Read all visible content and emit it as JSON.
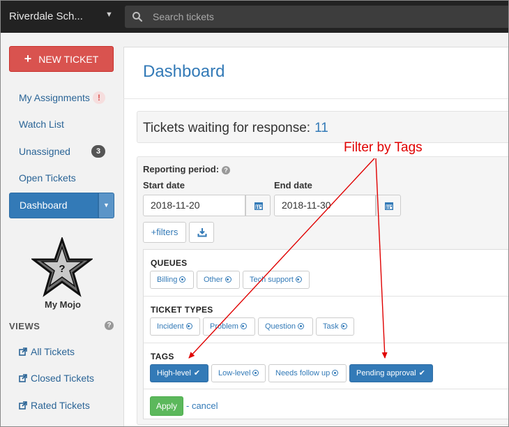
{
  "topbar": {
    "org_name": "Riverdale Sch...",
    "search_placeholder": "Search tickets"
  },
  "sidebar": {
    "new_ticket_label": "NEW TICKET",
    "items": [
      {
        "label": "My Assignments",
        "badge": "!"
      },
      {
        "label": "Watch List"
      },
      {
        "label": "Unassigned",
        "badge": "3"
      },
      {
        "label": "Open Tickets"
      },
      {
        "label": "Dashboard",
        "active": true
      }
    ],
    "mojo": {
      "label": "My Mojo",
      "glyph": "?"
    },
    "views_heading": "VIEWS",
    "views_help": "?",
    "views": [
      {
        "label": "All Tickets"
      },
      {
        "label": "Closed Tickets"
      },
      {
        "label": "Rated Tickets"
      }
    ]
  },
  "main": {
    "title": "Dashboard",
    "waiting_label": "Tickets waiting for response:",
    "waiting_count": "11",
    "report": {
      "period_label": "Reporting period:",
      "start_label": "Start date",
      "start_value": "2018-11-20",
      "end_label": "End date",
      "end_value": "2018-11-30",
      "filters_button": "+filters"
    },
    "filters": {
      "queues": {
        "heading": "QUEUES",
        "options": [
          "Billing",
          "Other",
          "Tech support"
        ]
      },
      "ticket_types": {
        "heading": "TICKET TYPES",
        "options": [
          "Incident",
          "Problem",
          "Question",
          "Task"
        ]
      },
      "tags": {
        "heading": "TAGS",
        "options": [
          {
            "label": "High-level",
            "selected": true
          },
          {
            "label": "Low-level",
            "selected": false
          },
          {
            "label": "Needs follow up",
            "selected": false
          },
          {
            "label": "Pending approval",
            "selected": true
          }
        ]
      },
      "apply_label": "Apply",
      "cancel_label": "- cancel"
    }
  },
  "annotation": {
    "text": "Filter by Tags",
    "color": "#e00000"
  },
  "colors": {
    "primary": "#337ab7",
    "danger": "#d9534f",
    "success": "#5cb85c",
    "topbar": "#222222"
  }
}
